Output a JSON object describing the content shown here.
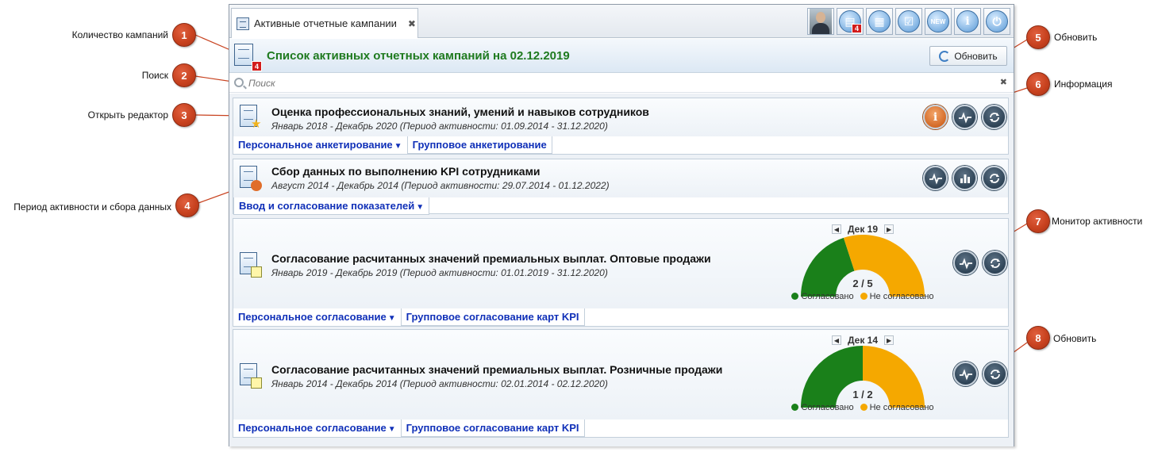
{
  "callouts": [
    {
      "num": "1",
      "label": "Количество кампаний"
    },
    {
      "num": "2",
      "label": "Поиск"
    },
    {
      "num": "3",
      "label": "Открыть редактор"
    },
    {
      "num": "4",
      "label": "Период активности и сбора данных"
    },
    {
      "num": "5",
      "label": "Обновить"
    },
    {
      "num": "6",
      "label": "Информация"
    },
    {
      "num": "7",
      "label": "Монитор активности"
    },
    {
      "num": "8",
      "label": "Обновить"
    }
  ],
  "tab": {
    "label": "Активные отчетные кампании",
    "close": "✖"
  },
  "toolbar": {
    "badge_count": "4",
    "new_label": "NEW",
    "info_glyph": "i"
  },
  "header": {
    "count": "4",
    "title": "Список активных отчетных кампаний на 02.12.2019",
    "refresh_label": "Обновить"
  },
  "search": {
    "placeholder": "Поиск",
    "clear": "✖"
  },
  "campaigns": [
    {
      "title": "Оценка профессиональных знаний, умений и навыков сотрудников",
      "period": "Январь 2018  - Декабрь 2020 (Период активности: 01.09.2014 - 31.12.2020)",
      "tabs": [
        "Персональное анкетирование",
        "Групповое анкетирование"
      ],
      "info_glyph": "i"
    },
    {
      "title": "Сбор данных по выполнению KPI сотрудниками",
      "period": "Август 2014  - Декабрь 2014 (Период активности: 29.07.2014 - 01.12.2022)",
      "tabs": [
        "Ввод и согласование показателей"
      ]
    },
    {
      "title": "Согласование расчитанных значений премиальных выплат. Оптовые продажи",
      "period": "Январь 2019  - Декабрь 2019 (Период активности: 01.01.2019 - 31.12.2020)",
      "tabs": [
        "Персональное согласование",
        "Групповое согласование карт KPI"
      ],
      "gauge": {
        "month": "Дек 19",
        "value_text": "2 / 5",
        "approved": 2,
        "total": 5
      }
    },
    {
      "title": "Согласование расчитанных значений премиальных выплат. Розничные продажи",
      "period": "Январь 2014  - Декабрь 2014 (Период активности: 02.01.2014 - 02.12.2020)",
      "tabs": [
        "Персональное согласование",
        "Групповое согласование карт KPI"
      ],
      "gauge": {
        "month": "Дек 14",
        "value_text": "1 / 2",
        "approved": 1,
        "total": 2
      }
    }
  ],
  "legend": {
    "approved": "Согласовано",
    "not_approved": "Не согласовано"
  },
  "colors": {
    "approved": "#1a801a",
    "not_approved": "#f5a800",
    "title_green": "#1f7a1f",
    "tab_link": "#1030b8"
  }
}
